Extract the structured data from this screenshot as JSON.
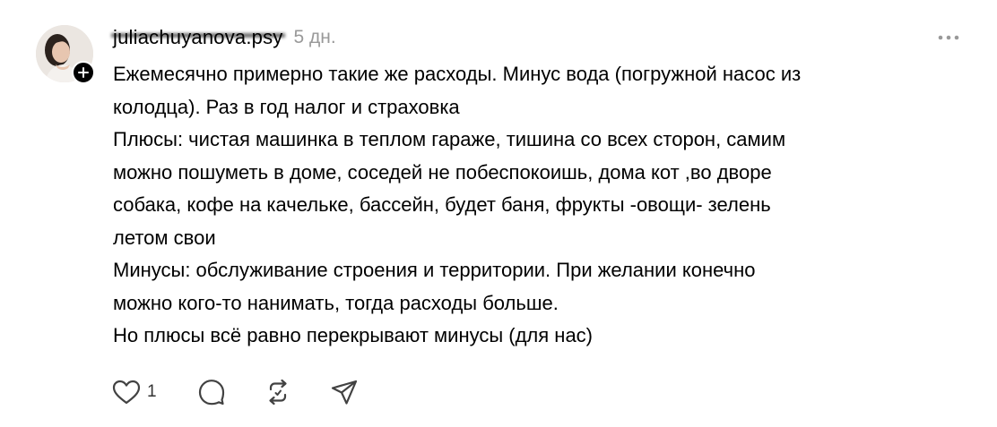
{
  "post": {
    "username": "juliachuyanova.psy",
    "time": "5 дн.",
    "lines": [
      "Ежемесячно примерно такие же расходы. Минус вода (погружной насос из",
      "колодца). Раз в год налог и страховка",
      "Плюсы: чистая машинка в теплом гараже, тишина со всех сторон, самим",
      "можно пошуметь в доме, соседей не побеспокоишь, дома кот ,во дворе",
      "собака, кофе на качельке, бассейн, будет баня, фрукты -овощи- зелень",
      "летом свои",
      "Минусы: обслуживание строения и территории. При желании конечно",
      "можно кого-то нанимать, тогда расходы больше.",
      "Но плюсы всё равно перекрывают минусы (для нас)"
    ],
    "like_count": "1"
  },
  "icons": {
    "avatar": "profile-photo",
    "follow": "plus-icon",
    "more": "more-horizontal-icon",
    "like": "heart-icon",
    "reply": "comment-icon",
    "repost": "repost-icon",
    "share": "send-icon"
  },
  "colors": {
    "text": "#000000",
    "muted": "#999999",
    "icon": "#424242"
  }
}
